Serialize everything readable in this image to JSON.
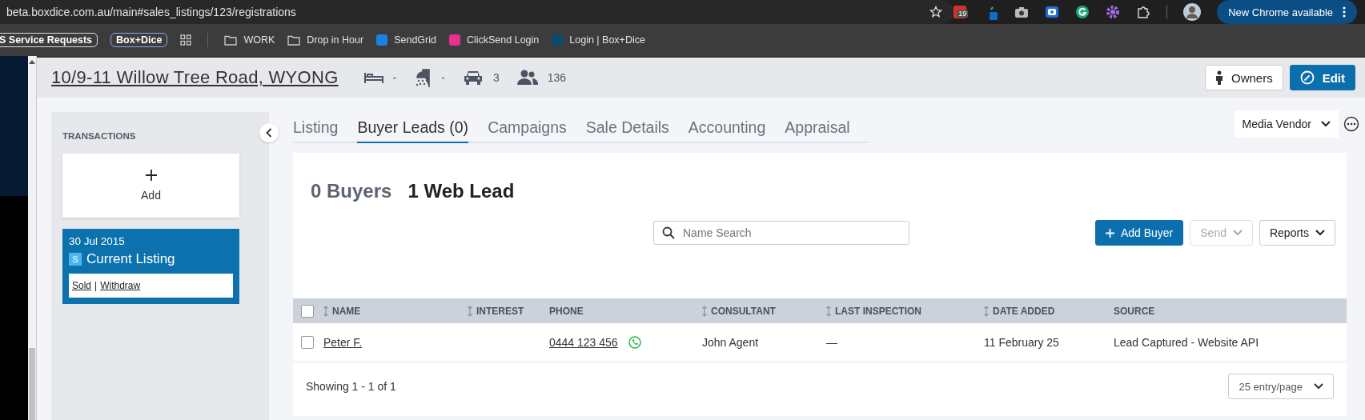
{
  "browser": {
    "url": "beta.boxdice.com.au/main#sales_listings/123/registrations",
    "extension_badge": "19",
    "update_button": "New Chrome available",
    "bookmarks": [
      {
        "kind": "chip",
        "label": "S Service Requests"
      },
      {
        "kind": "chip-accent",
        "label": "Box+Dice"
      },
      {
        "kind": "apps"
      },
      {
        "kind": "folder",
        "label": "WORK"
      },
      {
        "kind": "folder",
        "label": "Drop in Hour"
      },
      {
        "kind": "site",
        "label": "SendGrid",
        "color": "#1a82e2"
      },
      {
        "kind": "site",
        "label": "ClickSend Login",
        "color": "#e8308c"
      },
      {
        "kind": "site",
        "label": "Login | Box+Dice",
        "color": "#0a4a6e"
      }
    ]
  },
  "listing": {
    "address": "10/9-11 Willow Tree Road, WYONG",
    "beds": "-",
    "baths": "-",
    "cars": "3",
    "contacts": "136",
    "buttons": [
      {
        "kind": "owners",
        "label": "Owners"
      },
      {
        "kind": "edit",
        "label": "Edit"
      }
    ]
  },
  "sidebar": {
    "heading": "TRANSACTIONS",
    "add_label": "Add",
    "transactions": [
      {
        "date": "30 Jul 2015",
        "badge": "S",
        "title": "Current Listing",
        "selected": true,
        "actions": [
          "Sold",
          "Withdraw"
        ],
        "separator": "|"
      }
    ]
  },
  "tabs": [
    {
      "label": "Listing",
      "selected": false
    },
    {
      "label": "Buyer Leads (0)",
      "selected": true
    },
    {
      "label": "Campaigns",
      "selected": false
    },
    {
      "label": "Sale Details",
      "selected": false
    },
    {
      "label": "Accounting",
      "selected": false
    },
    {
      "label": "Appraisal",
      "selected": false
    }
  ],
  "media_vendor": {
    "value": "Media Vendor"
  },
  "summary": {
    "buyers": "0 Buyers",
    "web_leads": "1 Web Lead"
  },
  "search": {
    "placeholder": "Name Search"
  },
  "actions": [
    {
      "label": "Add Buyer",
      "kind": "primary",
      "disabled": false
    },
    {
      "label": "Send",
      "kind": "dropdown",
      "disabled": true
    },
    {
      "label": "Reports",
      "kind": "dropdown",
      "disabled": false
    }
  ],
  "table": {
    "all_checked": false,
    "columns": [
      {
        "label": "NAME",
        "sortable": true
      },
      {
        "label": "INTEREST",
        "sortable": true
      },
      {
        "label": "PHONE",
        "sortable": false
      },
      {
        "label": "CONSULTANT",
        "sortable": true
      },
      {
        "label": "LAST INSPECTION",
        "sortable": true
      },
      {
        "label": "DATE ADDED",
        "sortable": true
      },
      {
        "label": "SOURCE",
        "sortable": false
      }
    ],
    "rows": [
      {
        "checked": false,
        "name": "Peter F.",
        "phone": "0444 123 456",
        "consultant": "John Agent",
        "last_inspection": "—",
        "date_added": "11 February 25",
        "source": "Lead Captured - Website API"
      }
    ]
  },
  "footer": {
    "showing": "Showing 1 - 1 of 1",
    "per_page": "25 entry/page"
  }
}
